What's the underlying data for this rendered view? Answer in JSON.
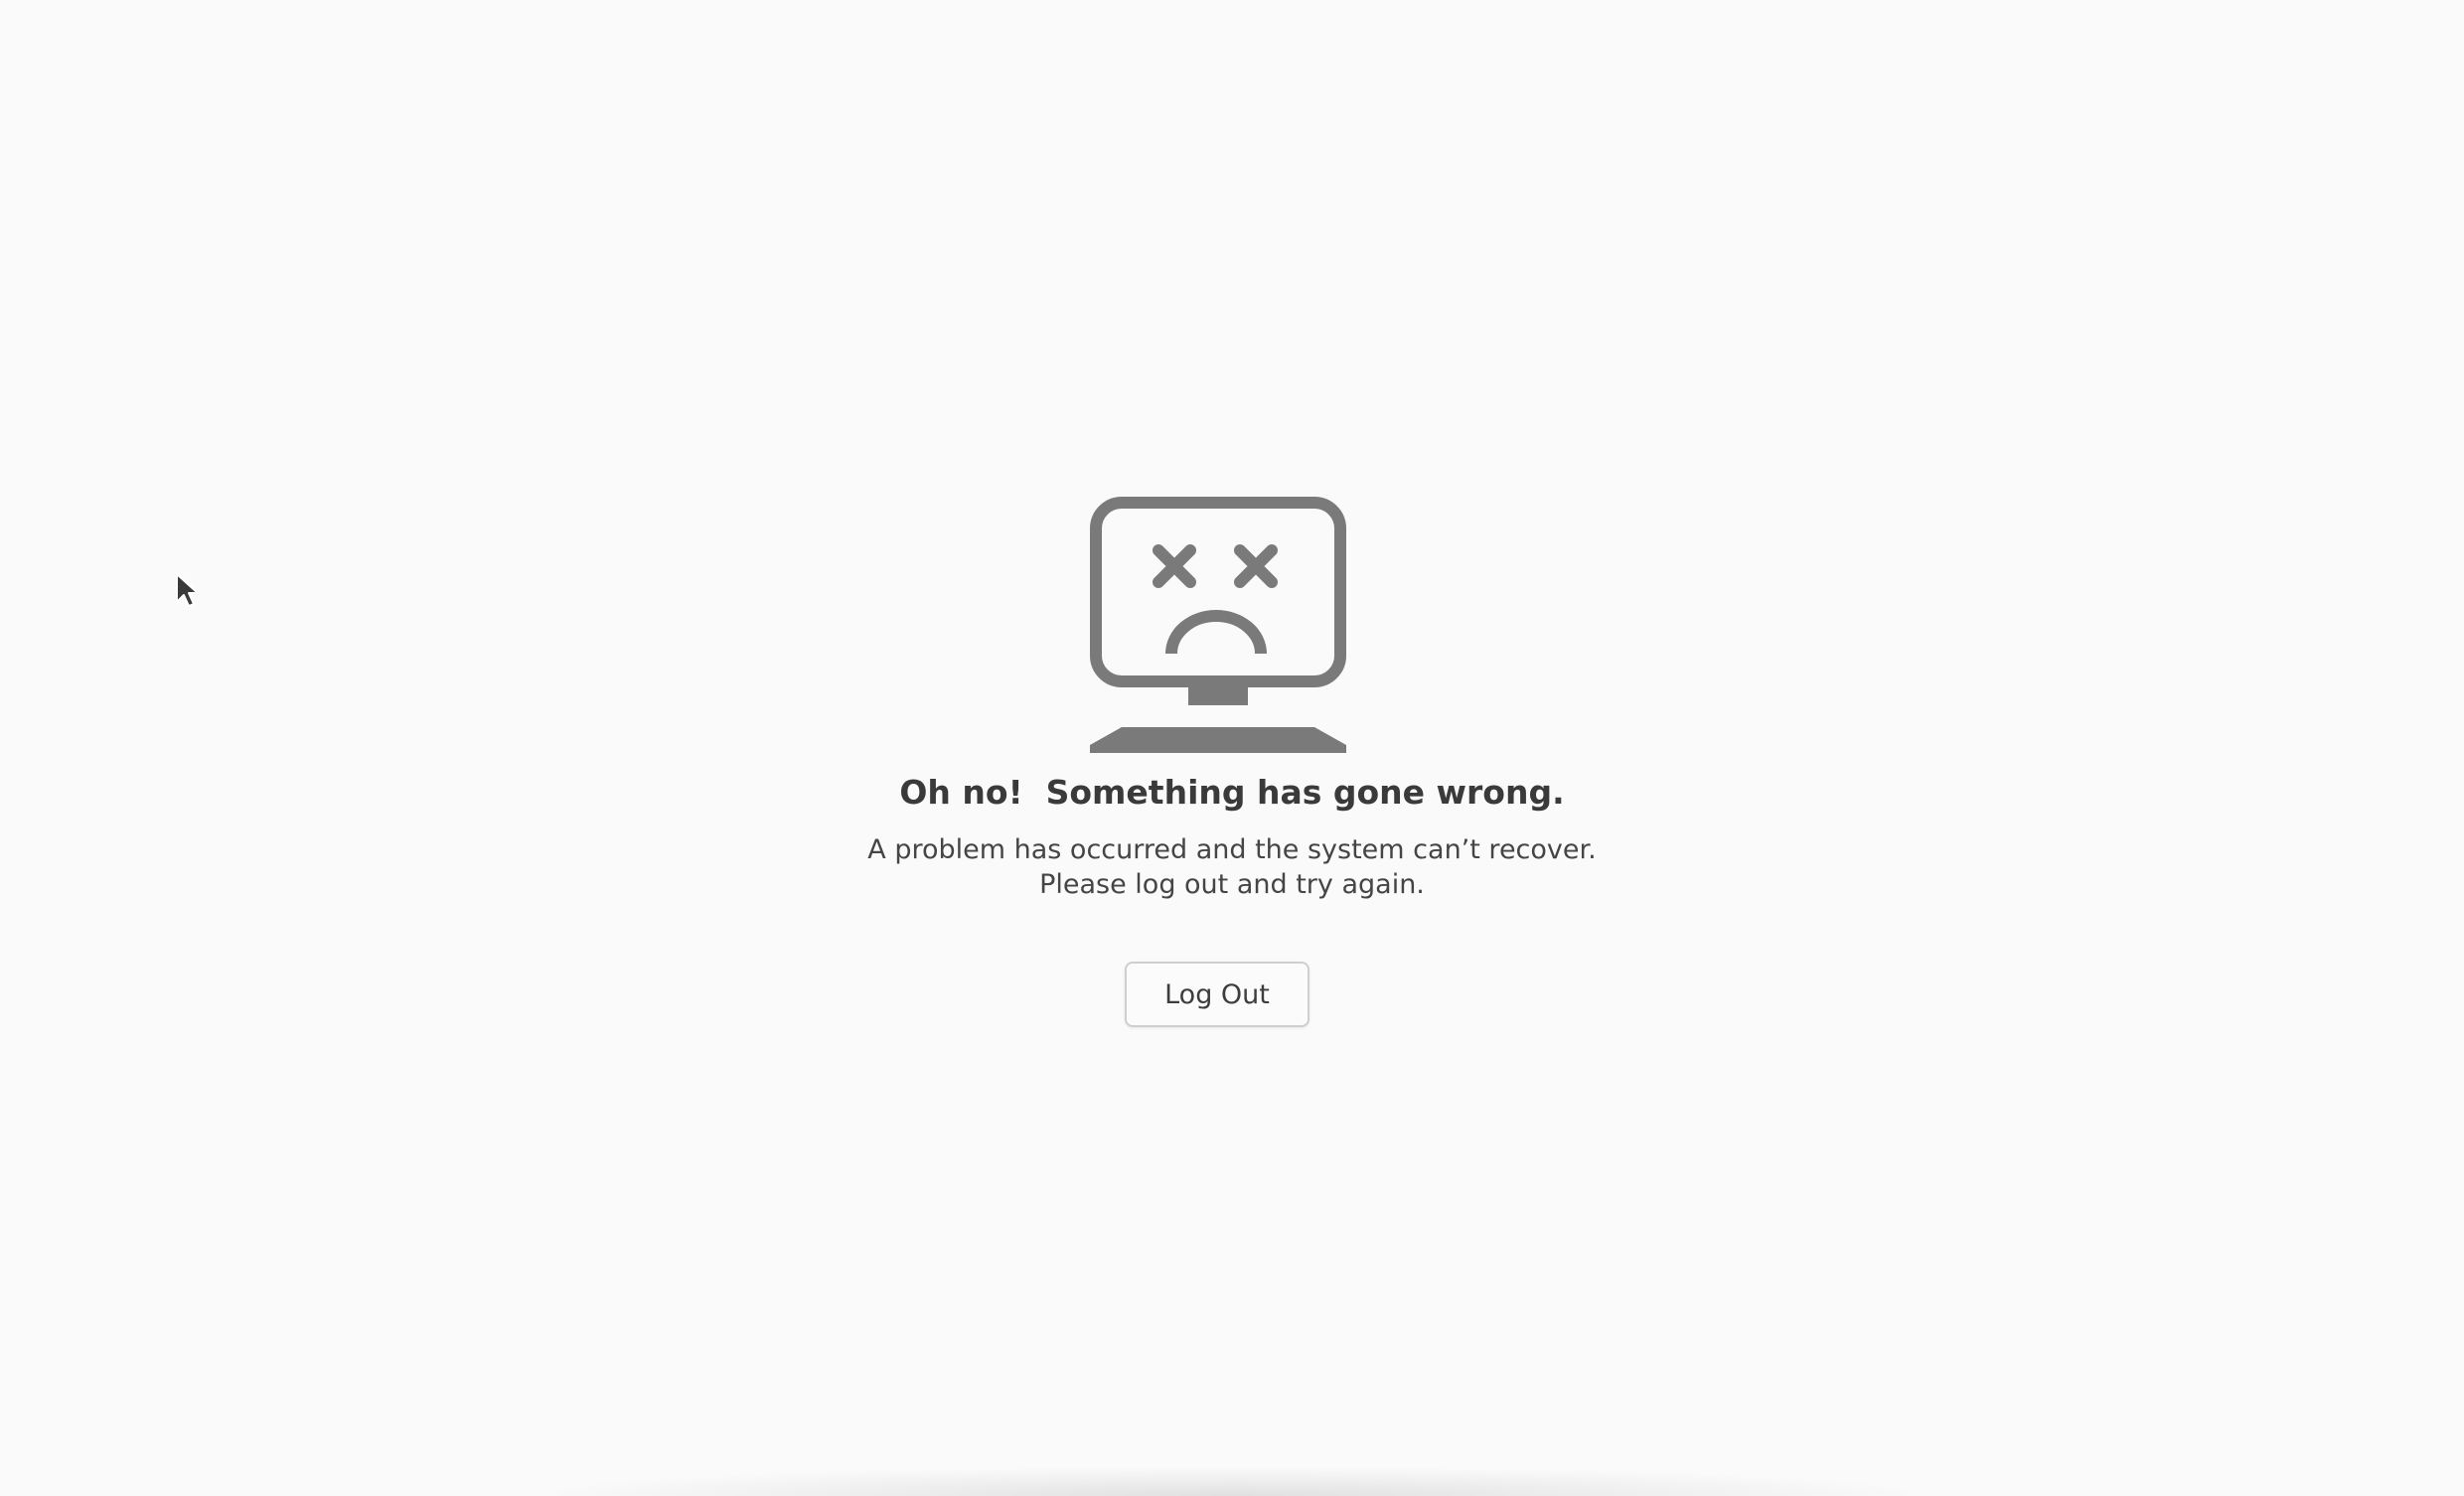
{
  "error_screen": {
    "icon": "sad-computer-icon",
    "title": "Oh no!  Something has gone wrong.",
    "message_line1": "A problem has occurred and the system can’t recover.",
    "message_line2": "Please log out and try again.",
    "logout_label": "Log Out"
  },
  "cursor": {
    "icon": "mouse-pointer-icon"
  },
  "colors": {
    "background": "#fafafa",
    "icon": "#7a7a7a",
    "text": "#3d3d3d"
  }
}
